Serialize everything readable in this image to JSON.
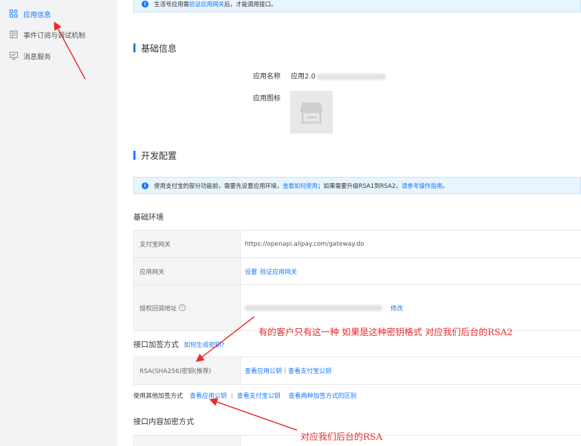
{
  "sidebar": {
    "items": [
      {
        "label": "应用信息",
        "icon": "grid-icon",
        "active": true
      },
      {
        "label": "事件订阅与调试机制",
        "icon": "list-icon",
        "active": false
      },
      {
        "label": "消息服务",
        "icon": "monitor-icon",
        "active": false
      }
    ]
  },
  "top_notice": {
    "prefix": "生活号应用需",
    "link": "验证应用网关",
    "suffix": "后，才能调用接口。"
  },
  "basic_info": {
    "title": "基础信息",
    "app_name_label": "应用名称",
    "app_name_value": "应用2.0",
    "app_icon_label": "应用图标"
  },
  "dev_config": {
    "title": "开发配置",
    "notice": {
      "part1": "使用支付宝的部分功能前，需要先设置应用环境，",
      "link1": "查看如何使用",
      "part2": "；如果需要升级RSA1到RSA2，",
      "link2": "请参考操作指南",
      "part3": "。"
    },
    "env_title": "基础环境",
    "env_rows": {
      "gateway_label": "支付宝网关",
      "gateway_value": "https://openapi.alipay.com/gateway.do",
      "app_gateway_label": "应用网关",
      "app_gateway_set": "设置",
      "app_gateway_verify": "验证应用网关",
      "callback_label": "授权回调地址",
      "callback_edit": "修改"
    },
    "sign_title": "接口加签方式",
    "sign_help_link": "如何生成密钥?",
    "sign_row": {
      "label": "RSA(SHA256)密钥(推荐)",
      "link1": "查看应用公钥",
      "sep": "|",
      "link2": "查看支付宝公钥"
    },
    "other_sign": {
      "label": "使用其他加签方式",
      "link1": "查看应用公钥",
      "sep": "|",
      "link2": "查看支付宝公钥",
      "link3": "查看两种加签方式的区别"
    },
    "encrypt_title": "接口内容加密方式"
  },
  "annotations": {
    "note1": "有的客户只有这一种 如果是这种密钥格式 对应我们后台的RSA2",
    "note2": "对应我们后台的RSA",
    "color": "#ee2a2a"
  }
}
